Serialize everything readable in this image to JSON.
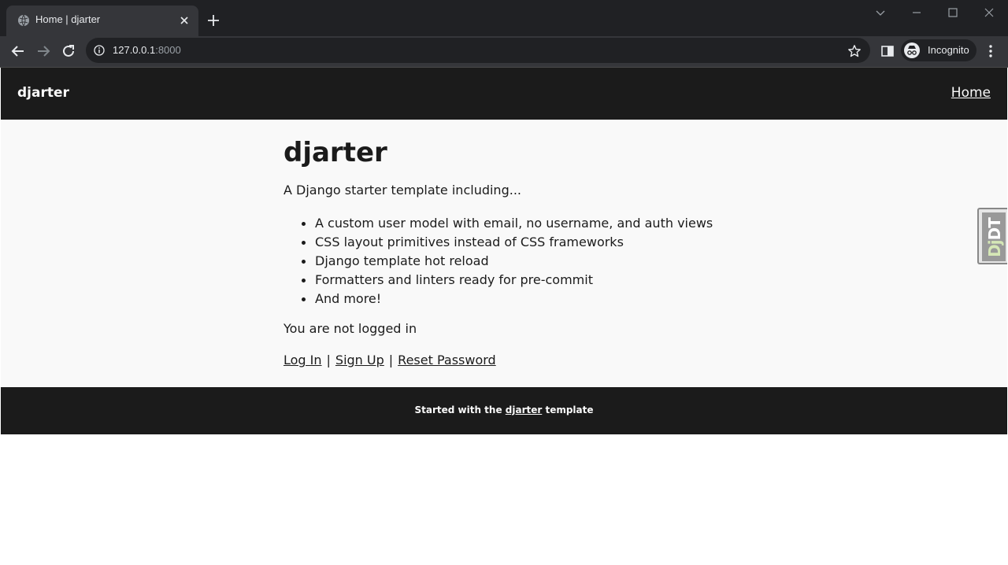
{
  "browser": {
    "tab_title": "Home | djarter",
    "url_host": "127.0.0.1",
    "url_port": ":8000",
    "profile_label": "Incognito"
  },
  "site": {
    "brand": "djarter",
    "nav_home": "Home"
  },
  "main": {
    "heading": "djarter",
    "intro": "A Django starter template including...",
    "features": [
      "A custom user model with email, no username, and auth views",
      "CSS layout primitives instead of CSS frameworks",
      "Django template hot reload",
      "Formatters and linters ready for pre-commit",
      "And more!"
    ],
    "status": "You are not logged in",
    "links": {
      "login": "Log In",
      "signup": "Sign Up",
      "reset": "Reset Password",
      "separator": "|"
    }
  },
  "debug_toolbar": {
    "label_prefix": "Dj",
    "label_suffix": "DT"
  },
  "footer": {
    "prefix": "Started with the ",
    "link": "djarter",
    "suffix": " template"
  },
  "icons": {
    "tab_favicon": "globe-icon",
    "tab_close": "close-icon",
    "new_tab": "plus-icon",
    "back": "back-arrow-icon",
    "forward": "forward-arrow-icon",
    "reload": "reload-icon",
    "site_info": "info-icon",
    "bookmark": "star-icon",
    "side_panel": "side-panel-icon",
    "incognito": "incognito-icon",
    "menu": "kebab-menu-icon"
  },
  "colors": {
    "header_bg": "#1b1b1b",
    "main_bg": "#f9f9f9",
    "text": "#1b1b1b",
    "chrome_dark": "#202124",
    "chrome_tab": "#35363a"
  }
}
